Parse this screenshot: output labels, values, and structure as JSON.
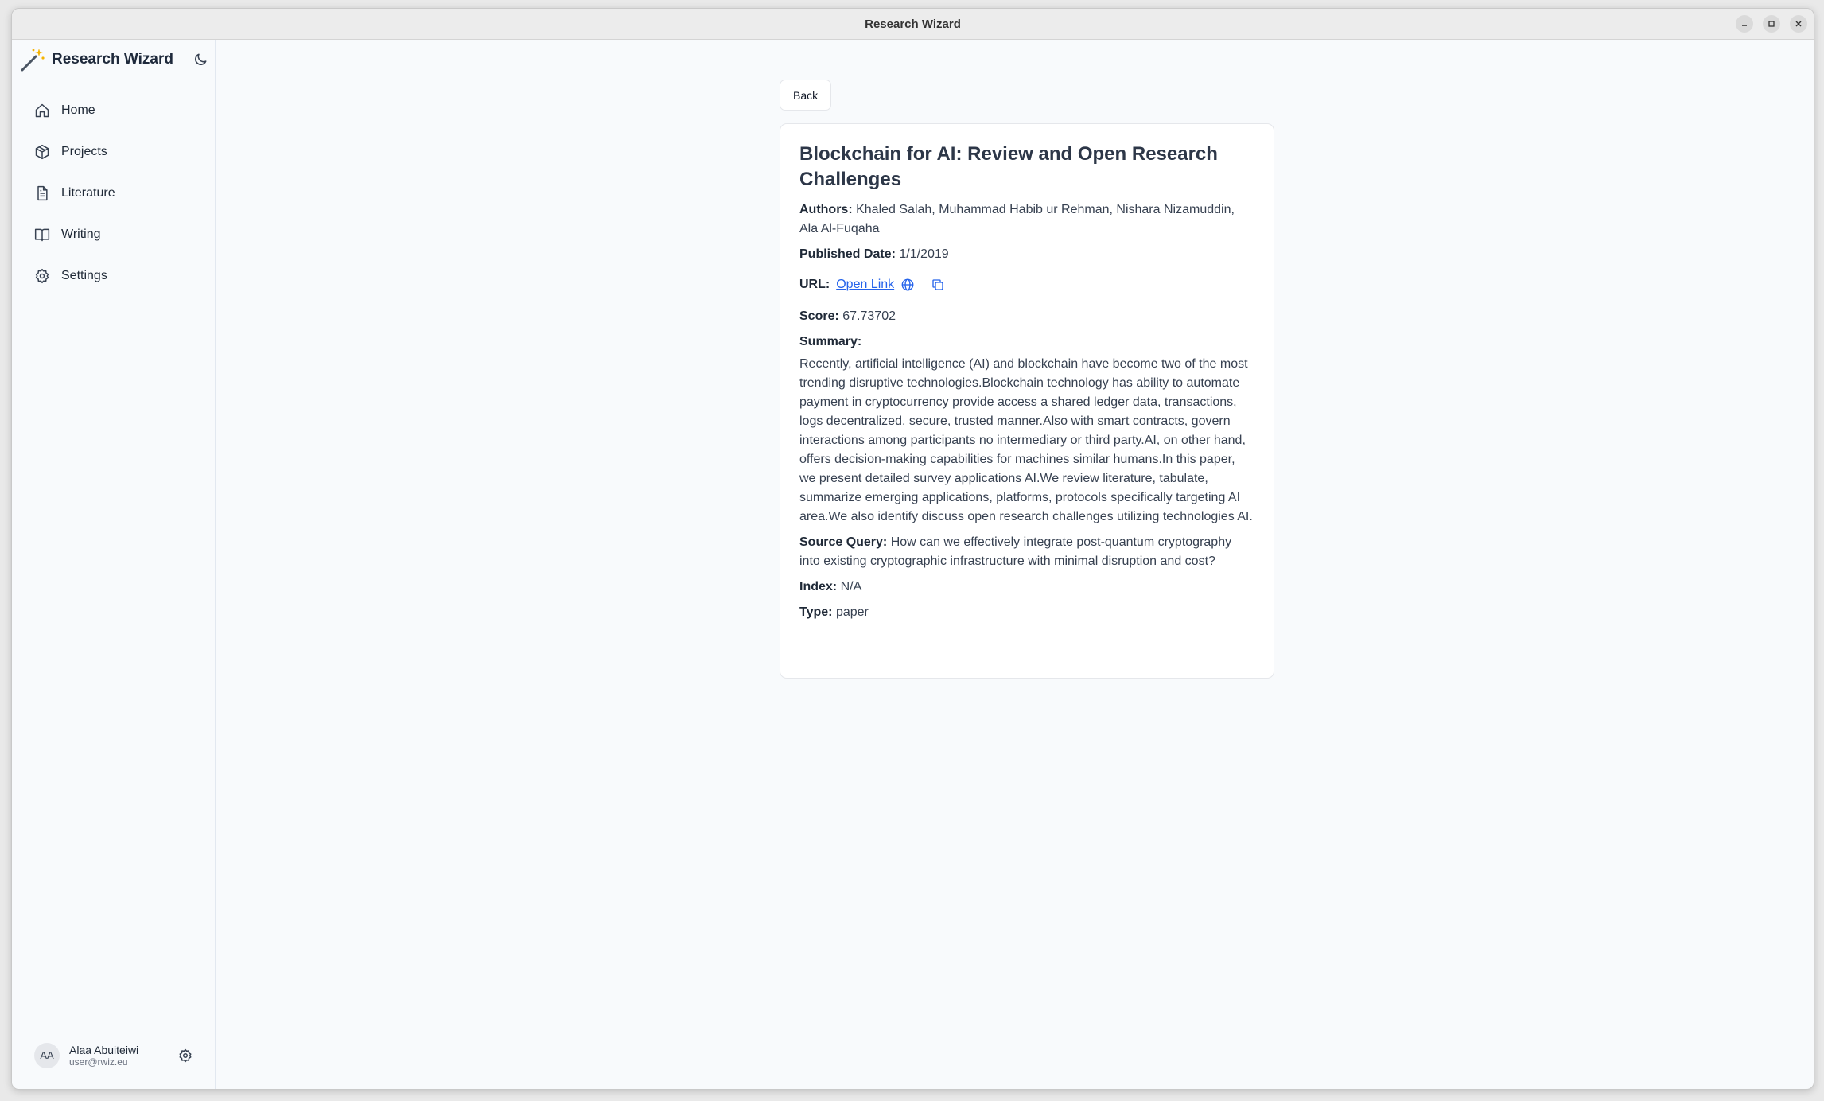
{
  "window": {
    "title": "Research Wizard"
  },
  "sidebar": {
    "brand": "Research Wizard",
    "items": [
      {
        "label": "Home",
        "icon": "home-icon"
      },
      {
        "label": "Projects",
        "icon": "box-icon"
      },
      {
        "label": "Literature",
        "icon": "file-text-icon"
      },
      {
        "label": "Writing",
        "icon": "book-open-icon"
      },
      {
        "label": "Settings",
        "icon": "gear-icon"
      }
    ],
    "user": {
      "initials": "AA",
      "name": "Alaa Abuiteiwi",
      "email": "user@rwiz.eu"
    }
  },
  "main": {
    "back_label": "Back",
    "paper": {
      "title": "Blockchain for AI: Review and Open Research Challenges",
      "authors_label": "Authors:",
      "authors": "Khaled Salah, Muhammad Habib ur Rehman, Nishara Nizamuddin, Ala Al-Fuqaha",
      "published_label": "Published Date:",
      "published": "1/1/2019",
      "url_label": "URL:",
      "url_link_text": "Open Link",
      "score_label": "Score:",
      "score": "67.73702",
      "summary_label": "Summary:",
      "summary": "Recently, artificial intelligence (AI) and blockchain have become two of the most trending disruptive technologies.Blockchain technology has ability to automate payment in cryptocurrency provide access a shared ledger data, transactions, logs decentralized, secure, trusted manner.Also with smart contracts, govern interactions among participants no intermediary or third party.AI, on other hand, offers decision-making capabilities for machines similar humans.In this paper, we present detailed survey applications AI.We review literature, tabulate, summarize emerging applications, platforms, protocols specifically targeting AI area.We also identify discuss open research challenges utilizing technologies AI.",
      "source_query_label": "Source Query:",
      "source_query": "How can we effectively integrate post-quantum cryptography into existing cryptographic infrastructure with minimal disruption and cost?",
      "index_label": "Index:",
      "index": "N/A",
      "type_label": "Type:",
      "type": "paper"
    }
  },
  "colors": {
    "link": "#2563eb",
    "brand_wand_star": "#f5b301"
  }
}
